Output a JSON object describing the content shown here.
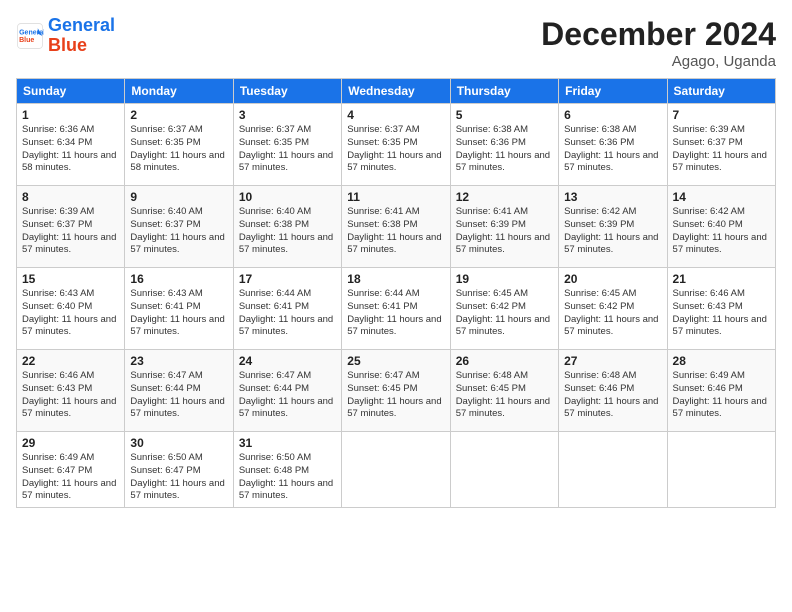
{
  "header": {
    "logo_line1": "General",
    "logo_line2": "Blue",
    "month": "December 2024",
    "location": "Agago, Uganda"
  },
  "weekdays": [
    "Sunday",
    "Monday",
    "Tuesday",
    "Wednesday",
    "Thursday",
    "Friday",
    "Saturday"
  ],
  "weeks": [
    [
      {
        "day": "1",
        "sunrise": "6:36 AM",
        "sunset": "6:34 PM",
        "daylight": "11 hours and 58 minutes."
      },
      {
        "day": "2",
        "sunrise": "6:37 AM",
        "sunset": "6:35 PM",
        "daylight": "11 hours and 58 minutes."
      },
      {
        "day": "3",
        "sunrise": "6:37 AM",
        "sunset": "6:35 PM",
        "daylight": "11 hours and 57 minutes."
      },
      {
        "day": "4",
        "sunrise": "6:37 AM",
        "sunset": "6:35 PM",
        "daylight": "11 hours and 57 minutes."
      },
      {
        "day": "5",
        "sunrise": "6:38 AM",
        "sunset": "6:36 PM",
        "daylight": "11 hours and 57 minutes."
      },
      {
        "day": "6",
        "sunrise": "6:38 AM",
        "sunset": "6:36 PM",
        "daylight": "11 hours and 57 minutes."
      },
      {
        "day": "7",
        "sunrise": "6:39 AM",
        "sunset": "6:37 PM",
        "daylight": "11 hours and 57 minutes."
      }
    ],
    [
      {
        "day": "8",
        "sunrise": "6:39 AM",
        "sunset": "6:37 PM",
        "daylight": "11 hours and 57 minutes."
      },
      {
        "day": "9",
        "sunrise": "6:40 AM",
        "sunset": "6:37 PM",
        "daylight": "11 hours and 57 minutes."
      },
      {
        "day": "10",
        "sunrise": "6:40 AM",
        "sunset": "6:38 PM",
        "daylight": "11 hours and 57 minutes."
      },
      {
        "day": "11",
        "sunrise": "6:41 AM",
        "sunset": "6:38 PM",
        "daylight": "11 hours and 57 minutes."
      },
      {
        "day": "12",
        "sunrise": "6:41 AM",
        "sunset": "6:39 PM",
        "daylight": "11 hours and 57 minutes."
      },
      {
        "day": "13",
        "sunrise": "6:42 AM",
        "sunset": "6:39 PM",
        "daylight": "11 hours and 57 minutes."
      },
      {
        "day": "14",
        "sunrise": "6:42 AM",
        "sunset": "6:40 PM",
        "daylight": "11 hours and 57 minutes."
      }
    ],
    [
      {
        "day": "15",
        "sunrise": "6:43 AM",
        "sunset": "6:40 PM",
        "daylight": "11 hours and 57 minutes."
      },
      {
        "day": "16",
        "sunrise": "6:43 AM",
        "sunset": "6:41 PM",
        "daylight": "11 hours and 57 minutes."
      },
      {
        "day": "17",
        "sunrise": "6:44 AM",
        "sunset": "6:41 PM",
        "daylight": "11 hours and 57 minutes."
      },
      {
        "day": "18",
        "sunrise": "6:44 AM",
        "sunset": "6:41 PM",
        "daylight": "11 hours and 57 minutes."
      },
      {
        "day": "19",
        "sunrise": "6:45 AM",
        "sunset": "6:42 PM",
        "daylight": "11 hours and 57 minutes."
      },
      {
        "day": "20",
        "sunrise": "6:45 AM",
        "sunset": "6:42 PM",
        "daylight": "11 hours and 57 minutes."
      },
      {
        "day": "21",
        "sunrise": "6:46 AM",
        "sunset": "6:43 PM",
        "daylight": "11 hours and 57 minutes."
      }
    ],
    [
      {
        "day": "22",
        "sunrise": "6:46 AM",
        "sunset": "6:43 PM",
        "daylight": "11 hours and 57 minutes."
      },
      {
        "day": "23",
        "sunrise": "6:47 AM",
        "sunset": "6:44 PM",
        "daylight": "11 hours and 57 minutes."
      },
      {
        "day": "24",
        "sunrise": "6:47 AM",
        "sunset": "6:44 PM",
        "daylight": "11 hours and 57 minutes."
      },
      {
        "day": "25",
        "sunrise": "6:47 AM",
        "sunset": "6:45 PM",
        "daylight": "11 hours and 57 minutes."
      },
      {
        "day": "26",
        "sunrise": "6:48 AM",
        "sunset": "6:45 PM",
        "daylight": "11 hours and 57 minutes."
      },
      {
        "day": "27",
        "sunrise": "6:48 AM",
        "sunset": "6:46 PM",
        "daylight": "11 hours and 57 minutes."
      },
      {
        "day": "28",
        "sunrise": "6:49 AM",
        "sunset": "6:46 PM",
        "daylight": "11 hours and 57 minutes."
      }
    ],
    [
      {
        "day": "29",
        "sunrise": "6:49 AM",
        "sunset": "6:47 PM",
        "daylight": "11 hours and 57 minutes."
      },
      {
        "day": "30",
        "sunrise": "6:50 AM",
        "sunset": "6:47 PM",
        "daylight": "11 hours and 57 minutes."
      },
      {
        "day": "31",
        "sunrise": "6:50 AM",
        "sunset": "6:48 PM",
        "daylight": "11 hours and 57 minutes."
      },
      null,
      null,
      null,
      null
    ]
  ]
}
